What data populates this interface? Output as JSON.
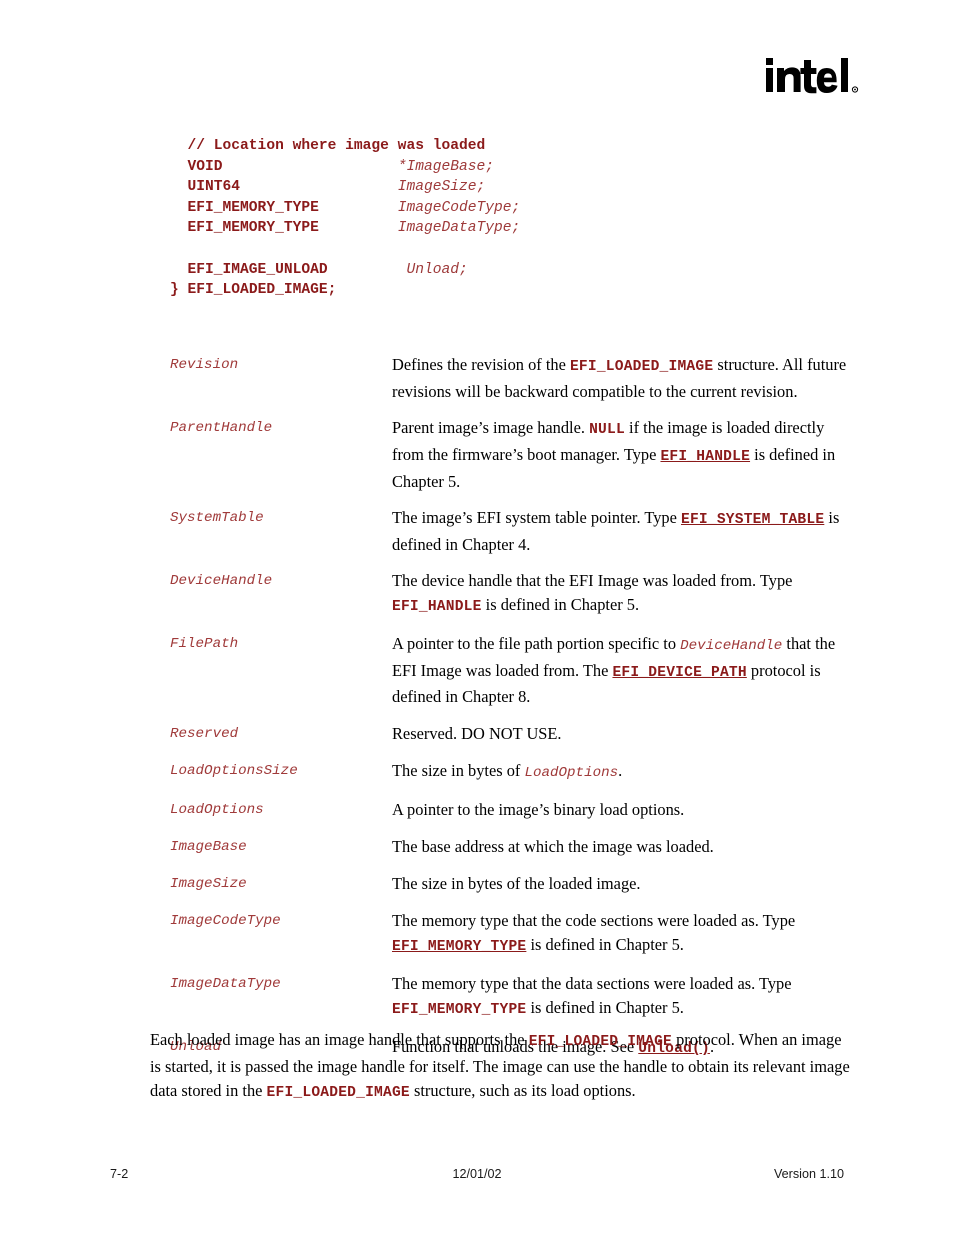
{
  "logo": {
    "wordmark": "intel",
    "alt": "intel-logo"
  },
  "code_block": {
    "lines": [
      {
        "indent": true,
        "parts": [
          {
            "t": "// Location where image was loaded",
            "s": "cmt"
          }
        ]
      },
      {
        "indent": true,
        "parts": [
          {
            "t": "VOID",
            "s": "kw",
            "pad": 24
          },
          {
            "t": "*ImageBase;",
            "s": "id"
          }
        ]
      },
      {
        "indent": true,
        "parts": [
          {
            "t": "UINT64",
            "s": "kw",
            "pad": 24
          },
          {
            "t": "ImageSize;",
            "s": "id"
          }
        ]
      },
      {
        "indent": true,
        "parts": [
          {
            "t": "EFI_MEMORY_TYPE",
            "s": "kw",
            "pad": 24
          },
          {
            "t": "ImageCodeType;",
            "s": "id"
          }
        ]
      },
      {
        "indent": true,
        "parts": [
          {
            "t": "EFI_MEMORY_TYPE",
            "s": "kw",
            "pad": 24
          },
          {
            "t": "ImageDataType;",
            "s": "id"
          }
        ]
      },
      {
        "blank": true
      },
      {
        "indent": true,
        "parts": [
          {
            "t": "EFI_IMAGE_UNLOAD",
            "s": "kw",
            "pad": 25
          },
          {
            "t": "Unload;",
            "s": "id"
          }
        ]
      },
      {
        "indent": false,
        "parts": [
          {
            "t": "} EFI_LOADED_IMAGE;",
            "s": "kw"
          }
        ]
      }
    ]
  },
  "definitions": [
    {
      "term": "Revision",
      "desc_parts": [
        {
          "t": "Defines the revision of the ",
          "s": "plain"
        },
        {
          "t": "EFI_LOADED_IMAGE",
          "s": "mono-b"
        },
        {
          "t": " structure. All future revisions will be backward compatible to the current revision.",
          "s": "plain"
        }
      ]
    },
    {
      "term": "ParentHandle",
      "desc_parts": [
        {
          "t": "Parent image’s image handle.  ",
          "s": "plain"
        },
        {
          "t": "NULL",
          "s": "mono-b"
        },
        {
          "t": " if the image is loaded directly from the firmware’s boot manager.  Type ",
          "s": "plain"
        },
        {
          "t": "EFI_HANDLE",
          "s": "mono-b-link"
        },
        {
          "t": " is defined in Chapter 5.",
          "s": "plain"
        }
      ]
    },
    {
      "term": "SystemTable",
      "desc_parts": [
        {
          "t": "The image’s EFI system table pointer.  Type ",
          "s": "plain"
        },
        {
          "t": "EFI_SYSTEM_TABLE",
          "s": "mono-b-link"
        },
        {
          "t": " is defined in Chapter 4.",
          "s": "plain"
        }
      ]
    },
    {
      "term": "DeviceHandle",
      "desc_parts": [
        {
          "t": "The device handle that the EFI Image was loaded from.  Type ",
          "s": "plain"
        },
        {
          "t": "EFI_HANDLE",
          "s": "mono-b"
        },
        {
          "t": " is defined in Chapter 5.",
          "s": "plain"
        }
      ]
    },
    {
      "term": "FilePath",
      "desc_parts": [
        {
          "t": "A pointer to the file path portion specific to ",
          "s": "plain"
        },
        {
          "t": "DeviceHandle",
          "s": "mono-i"
        },
        {
          "t": " that the EFI Image was loaded from.  The ",
          "s": "plain"
        },
        {
          "t": "EFI_DEVICE_PATH",
          "s": "mono-b-link"
        },
        {
          "t": " protocol is defined in Chapter 8.",
          "s": "plain"
        }
      ]
    },
    {
      "term": "Reserved",
      "desc_parts": [
        {
          "t": "Reserved.  DO NOT USE.",
          "s": "plain"
        }
      ]
    },
    {
      "term": "LoadOptionsSize",
      "desc_parts": [
        {
          "t": "The size in bytes of ",
          "s": "plain"
        },
        {
          "t": "LoadOptions",
          "s": "mono-i"
        },
        {
          "t": ".",
          "s": "plain"
        }
      ]
    },
    {
      "term": "LoadOptions",
      "desc_parts": [
        {
          "t": "A pointer to the image’s binary load options.",
          "s": "plain"
        }
      ]
    },
    {
      "term": "ImageBase",
      "desc_parts": [
        {
          "t": "The base address at which the image was loaded.",
          "s": "plain"
        }
      ]
    },
    {
      "term": "ImageSize",
      "desc_parts": [
        {
          "t": "The size in bytes of the loaded image.",
          "s": "plain"
        }
      ]
    },
    {
      "term": "ImageCodeType",
      "desc_parts": [
        {
          "t": "The memory type that the code sections were loaded as.  Type ",
          "s": "plain"
        },
        {
          "t": "EFI_MEMORY_TYPE",
          "s": "mono-b-link"
        },
        {
          "t": " is defined in Chapter 5.",
          "s": "plain"
        }
      ]
    },
    {
      "term": "ImageDataType",
      "desc_parts": [
        {
          "t": "The memory type that the data sections were loaded as.   Type ",
          "s": "plain"
        },
        {
          "t": "EFI_MEMORY_TYPE",
          "s": "mono-b"
        },
        {
          "t": " is defined in Chapter 5.",
          "s": "plain"
        }
      ]
    },
    {
      "term": "Unload",
      "desc_parts": [
        {
          "t": "Function that unloads the image.  See ",
          "s": "plain"
        },
        {
          "t": "Unload()",
          "s": "mono-b-link"
        },
        {
          "t": ".",
          "s": "plain"
        }
      ]
    }
  ],
  "closing_paragraph": {
    "parts": [
      {
        "t": "Each loaded image has an image handle that supports the ",
        "s": "plain"
      },
      {
        "t": "EFI_LOADED_IMAGE",
        "s": "mono-b"
      },
      {
        "t": " protocol.  When an image is started, it is passed the image handle for itself.  The image can use the handle to obtain its relevant image data stored in the ",
        "s": "plain"
      },
      {
        "t": "EFI_LOADED_IMAGE",
        "s": "mono-b"
      },
      {
        "t": " structure, such as its load options.",
        "s": "plain"
      }
    ]
  },
  "footer": {
    "page_number": "7-2",
    "date": "12/01/02",
    "version": "Version 1.10"
  },
  "colors": {
    "code_red": "#8B1A1A",
    "ident_red": "#A03A3A",
    "body_text": "#000000",
    "background": "#ffffff"
  }
}
